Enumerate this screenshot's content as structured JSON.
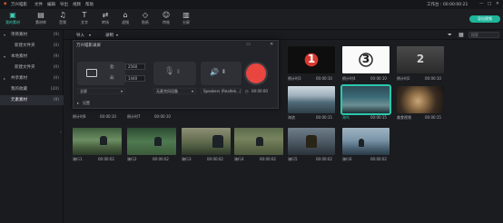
{
  "titlebar": {
    "app_name": "万兴喵影",
    "menu": [
      "文件",
      "编辑",
      "导出",
      "视频",
      "帮助"
    ],
    "status_text": "工作台 : 00:00:00:21"
  },
  "toolbar": {
    "items": [
      {
        "label": "我的素材",
        "icon": "folder-icon"
      },
      {
        "label": "素材库",
        "icon": "library-icon"
      },
      {
        "label": "音频",
        "icon": "music-icon"
      },
      {
        "label": "文字",
        "icon": "text-icon"
      },
      {
        "label": "转场",
        "icon": "transition-icon"
      },
      {
        "label": "滤镜",
        "icon": "filter-icon"
      },
      {
        "label": "贴纸",
        "icon": "sticker-icon"
      },
      {
        "label": "特效",
        "icon": "effect-icon"
      },
      {
        "label": "分屏",
        "icon": "split-icon"
      }
    ],
    "export_label": "导出视频"
  },
  "subbar": {
    "import_label": "导入",
    "record_label": "录制",
    "search_placeholder": "搜索"
  },
  "sidebar": {
    "items": [
      {
        "label": "项目素材",
        "count": "(9)"
      },
      {
        "label": "新建文件夹",
        "count": "(0)"
      },
      {
        "label": "本地素材",
        "count": "(9)"
      },
      {
        "label": "新建文件夹",
        "count": "(0)"
      },
      {
        "label": "共享素材",
        "count": "(0)"
      },
      {
        "label": "我的收藏",
        "count": "(20)"
      },
      {
        "label": "元素素材",
        "count": "(9)"
      }
    ]
  },
  "dialog": {
    "title": "万兴喵影录屏",
    "width_label": "宽:",
    "width_value": "2560",
    "height_label": "高:",
    "height_value": "1440",
    "region_select": "全屏",
    "mic_select": "无麦克风设备",
    "speaker_select": "Speakers (Realtek...)",
    "timer_value": "00:00:00",
    "settings_label": "设置"
  },
  "media": {
    "row0": [
      {
        "caption": "倒计时8",
        "duration": "00:00:10"
      },
      {
        "caption": "倒计时7",
        "duration": "00:00:10"
      }
    ],
    "row1": [
      {
        "caption": "倒计时3",
        "duration": "00:00:10",
        "number": "1"
      },
      {
        "caption": "倒计时4",
        "duration": "00:00:10",
        "number": "3"
      },
      {
        "caption": "倒计时2",
        "duration": "00:00:10",
        "number": "2"
      }
    ],
    "row2": [
      {
        "caption": "海浪",
        "duration": "00:00:15"
      },
      {
        "caption": "海鸟",
        "duration": "00:00:15"
      },
      {
        "caption": "美食视频",
        "duration": "00:00:15"
      }
    ],
    "row3": [
      {
        "caption": "骑行1",
        "duration": "00:00:02"
      },
      {
        "caption": "骑行2",
        "duration": "00:00:02"
      },
      {
        "caption": "骑行3",
        "duration": "00:00:02"
      },
      {
        "caption": "骑行4",
        "duration": "00:00:02"
      },
      {
        "caption": "骑行5",
        "duration": "00:00:02"
      },
      {
        "caption": "骑行6",
        "duration": "00:00:02"
      }
    ]
  }
}
